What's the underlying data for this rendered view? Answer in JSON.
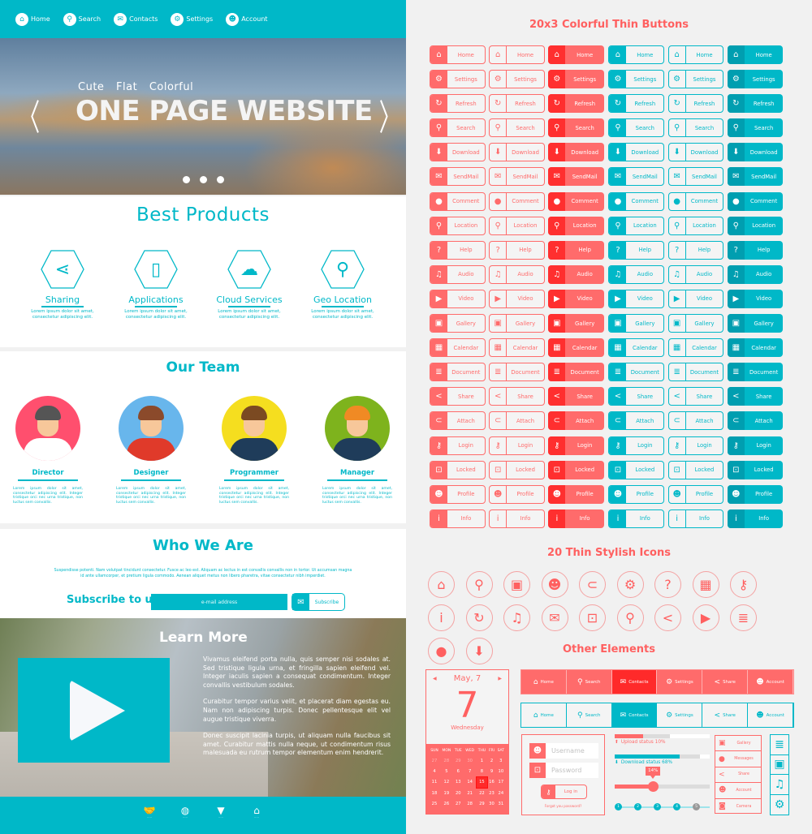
{
  "colors": {
    "teal": "#00b8c8",
    "coral": "#ff6b6b",
    "red": "#ff2f2f",
    "background": "#f1f1f1"
  },
  "nav": [
    {
      "label": "Home",
      "icon": "home-icon"
    },
    {
      "label": "Search",
      "icon": "search-icon"
    },
    {
      "label": "Contacts",
      "icon": "mail-icon"
    },
    {
      "label": "Settings",
      "icon": "gear-icon"
    },
    {
      "label": "Account",
      "icon": "account-icon"
    }
  ],
  "hero": {
    "subtitle": "Cute Flat Colorful",
    "title": "ONE PAGE WEBSITE",
    "prev": "〈",
    "next": "〉",
    "slides": 3
  },
  "products": {
    "title": "Best Products",
    "items": [
      {
        "label": "Sharing",
        "icon": "share-icon",
        "desc": "Lorem ipsum dolor sit amet, consectetur adipiscing elit."
      },
      {
        "label": "Applications",
        "icon": "smartphone-icon",
        "desc": "Lorem ipsum dolor sit amet, consectetur adipiscing elit."
      },
      {
        "label": "Cloud Services",
        "icon": "cloud-icon",
        "desc": "Lorem ipsum dolor sit amet, consectetur adipiscing elit."
      },
      {
        "label": "Geo Location",
        "icon": "map-icon",
        "desc": "Lorem ipsum dolor sit amet, consectetur adipiscing elit."
      }
    ]
  },
  "team": {
    "title": "Our Team",
    "members": [
      {
        "role": "Director",
        "desc": "Lorem ipsum dolor sit amet, consectetur adipiscing elit. Integer tristique orci nec urna tristique, non luctus sem convallis."
      },
      {
        "role": "Designer",
        "desc": "Lorem ipsum dolor sit amet, consectetur adipiscing elit. Integer tristique orci nec urna tristique, non luctus sem convallis."
      },
      {
        "role": "Programmer",
        "desc": "Lorem ipsum dolor sit amet, consectetur adipiscing elit. Integer tristique orci nec urna tristique, non luctus sem convallis."
      },
      {
        "role": "Manager",
        "desc": "Lorem ipsum dolor sit amet, consectetur adipiscing elit. Integer tristique orci nec urna tristique, non luctus sem convallis."
      }
    ]
  },
  "who": {
    "title": "Who We Are",
    "text": "Suspendisse potenti. Nam volutpat tincidunt consectetur. Fusce ac leo est. Aliquam ac lectus in est convallis convallis non in tortor. Ut accumsan magna id ante ullamcorper, et pretium ligula commodo. Aenean aliquet metus non libero pharetra, vitae consectetur nibh imperdiet.",
    "subscribe_label": "Subscribe to us",
    "email_placeholder": "e-mail address",
    "subscribe_button": "Subscribe"
  },
  "learn": {
    "title": "Learn More",
    "paragraphs": [
      "Vivamus eleifend porta nulla, quis semper nisi sodales at. Sed tristique ligula urna, et fringilla sapien eleifend vel. Integer iaculis sapien a consequat condimentum. Integer convallis vestibulum sodales.",
      "Curabitur tempor varius velit, et placerat diam egestas eu. Nam non adipiscing turpis. Donec pellentesque elit vel augue tristique viverra.",
      "Donec suscipit lacinia turpis, ut aliquam nulla faucibus sit amet. Curabitur mattis nulla neque, ut condimentum risus malesuada eu rutrum tempor elementum enim hendrerit."
    ]
  },
  "footer": {
    "icons": [
      "handshake-icon",
      "globe-icon",
      "box-icon",
      "house-icon"
    ]
  },
  "buttons": {
    "title": "20x3 Colorful Thin  Buttons",
    "items": [
      {
        "label": "Home",
        "icon": "home-icon",
        "glyph": "⌂"
      },
      {
        "label": "Settings",
        "icon": "gear-icon",
        "glyph": "⚙"
      },
      {
        "label": "Refresh",
        "icon": "refresh-icon",
        "glyph": "↻"
      },
      {
        "label": "Search",
        "icon": "search-icon",
        "glyph": "⚲"
      },
      {
        "label": "Download",
        "icon": "download-icon",
        "glyph": "⬇"
      },
      {
        "label": "SendMail",
        "icon": "mail-icon",
        "glyph": "✉"
      },
      {
        "label": "Comment",
        "icon": "comment-icon",
        "glyph": "●"
      },
      {
        "label": "Location",
        "icon": "location-pin-icon",
        "glyph": "⚲"
      },
      {
        "label": "Help",
        "icon": "help-icon",
        "glyph": "?"
      },
      {
        "label": "Audio",
        "icon": "music-note-icon",
        "glyph": "♫"
      },
      {
        "label": "Video",
        "icon": "video-clapper-icon",
        "glyph": "▶"
      },
      {
        "label": "Gallery",
        "icon": "gallery-icon",
        "glyph": "▣"
      },
      {
        "label": "Calendar",
        "icon": "calendar-icon",
        "glyph": "▦"
      },
      {
        "label": "Document",
        "icon": "document-icon",
        "glyph": "≣"
      },
      {
        "label": "Share",
        "icon": "share-icon",
        "glyph": "<"
      },
      {
        "label": "Attach",
        "icon": "paperclip-icon",
        "glyph": "⊂"
      },
      {
        "label": "Login",
        "icon": "key-icon",
        "glyph": "⚷"
      },
      {
        "label": "Locked",
        "icon": "padlock-icon",
        "glyph": "⊡"
      },
      {
        "label": "Profile",
        "icon": "profile-icon",
        "glyph": "☻"
      },
      {
        "label": "Info",
        "icon": "info-icon",
        "glyph": "i"
      }
    ],
    "styles": [
      "coral-filled-icon",
      "coral-outline",
      "coral-solid",
      "teal-filled-icon",
      "teal-outline",
      "teal-solid"
    ]
  },
  "icons": {
    "title": "20 Thin Stylish Icons",
    "items": [
      {
        "name": "home-icon",
        "glyph": "⌂"
      },
      {
        "name": "location-pin-icon",
        "glyph": "⚲"
      },
      {
        "name": "gallery-icon",
        "glyph": "▣"
      },
      {
        "name": "profile-icon",
        "glyph": "☻"
      },
      {
        "name": "paperclip-icon",
        "glyph": "⊂"
      },
      {
        "name": "gear-icon",
        "glyph": "⚙"
      },
      {
        "name": "help-icon",
        "glyph": "?"
      },
      {
        "name": "calendar-icon",
        "glyph": "▦"
      },
      {
        "name": "key-icon",
        "glyph": "⚷"
      },
      {
        "name": "info-icon",
        "glyph": "i"
      },
      {
        "name": "refresh-icon",
        "glyph": "↻"
      },
      {
        "name": "music-note-icon",
        "glyph": "♫"
      },
      {
        "name": "mail-icon",
        "glyph": "✉"
      },
      {
        "name": "padlock-icon",
        "glyph": "⊡"
      },
      {
        "name": "search-icon",
        "glyph": "⚲"
      },
      {
        "name": "share-icon",
        "glyph": "<"
      },
      {
        "name": "video-clapper-icon",
        "glyph": "▶"
      },
      {
        "name": "document-icon",
        "glyph": "≣"
      },
      {
        "name": "comment-icon",
        "glyph": "●"
      },
      {
        "name": "download-icon",
        "glyph": "⬇"
      }
    ]
  },
  "other": {
    "title": "Other Elements",
    "calendar": {
      "month_label": "May, 7",
      "day": "7",
      "weekday": "Wednesday",
      "headers": [
        "SUN",
        "MON",
        "TUE",
        "WED",
        "THU",
        "FRI",
        "SAT"
      ],
      "weeks": [
        [
          "27",
          "28",
          "29",
          "30",
          "1",
          "2",
          "3"
        ],
        [
          "4",
          "5",
          "6",
          "7",
          "8",
          "9",
          "10"
        ],
        [
          "11",
          "12",
          "13",
          "14",
          "15",
          "16",
          "17"
        ],
        [
          "18",
          "19",
          "20",
          "21",
          "22",
          "23",
          "24"
        ],
        [
          "25",
          "26",
          "27",
          "28",
          "29",
          "30",
          "31"
        ]
      ],
      "selected": "15"
    },
    "tabs": [
      {
        "label": "Home",
        "icon": "home-icon",
        "glyph": "⌂"
      },
      {
        "label": "Search",
        "icon": "search-icon",
        "glyph": "⚲"
      },
      {
        "label": "Contacts",
        "icon": "mail-icon",
        "glyph": "✉"
      },
      {
        "label": "Settings",
        "icon": "gear-icon",
        "glyph": "⚙"
      },
      {
        "label": "Share",
        "icon": "share-icon",
        "glyph": "<"
      },
      {
        "label": "Account",
        "icon": "account-icon",
        "glyph": "☻"
      }
    ],
    "active_tab": "Contacts",
    "login": {
      "username_placeholder": "Username",
      "password_placeholder": "Password",
      "button": "Log in",
      "forgot": "Forgot you password?"
    },
    "upload": {
      "label": "Upload status 10%",
      "percent": 10
    },
    "download": {
      "label": "Download status 68%",
      "percent": 68
    },
    "slider": {
      "label": "14%",
      "percent": 14
    },
    "steps": [
      "1",
      "2",
      "3",
      "4",
      "5"
    ],
    "active_steps": 4,
    "menu": [
      {
        "label": "Gallery",
        "icon": "gallery-icon",
        "glyph": "▣"
      },
      {
        "label": "Messages",
        "icon": "comment-icon",
        "glyph": "●"
      },
      {
        "label": "Share",
        "icon": "share-icon",
        "glyph": "<"
      },
      {
        "label": "Account",
        "icon": "account-icon",
        "glyph": "☻"
      },
      {
        "label": "Camera",
        "icon": "camera-icon",
        "glyph": "◙"
      }
    ],
    "icon_bar": [
      {
        "icon": "document-icon",
        "glyph": "≣"
      },
      {
        "icon": "gallery-icon",
        "glyph": "▣"
      },
      {
        "icon": "music-note-icon",
        "glyph": "♫"
      },
      {
        "icon": "gear-icon",
        "glyph": "⚙"
      }
    ]
  }
}
